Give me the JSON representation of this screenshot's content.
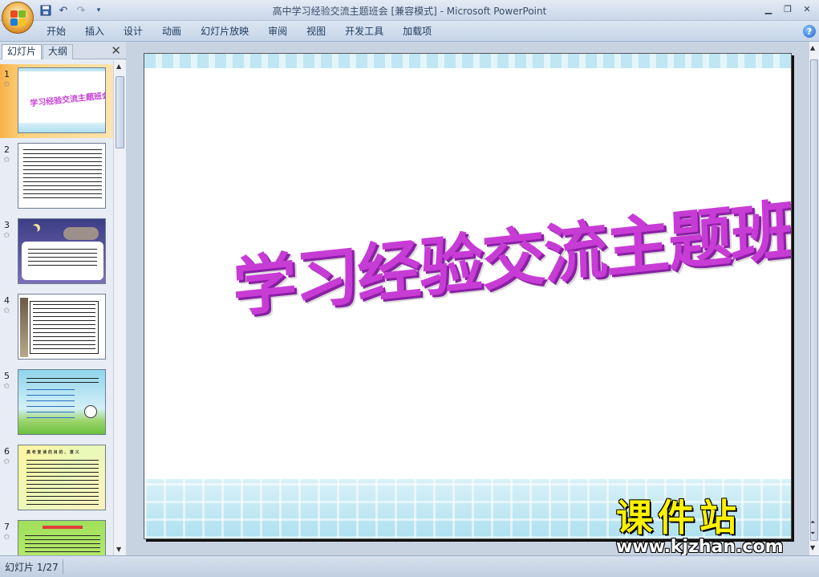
{
  "window": {
    "title": "高中学习经验交流主题班会 [兼容模式] - Microsoft PowerPoint",
    "controls": [
      "minimize-icon",
      "restore-icon",
      "close-icon"
    ]
  },
  "quick_access": [
    "save-icon",
    "undo-icon",
    "redo-icon",
    "customize-icon"
  ],
  "ribbon": {
    "tabs": [
      "开始",
      "插入",
      "设计",
      "动画",
      "幻灯片放映",
      "审阅",
      "视图",
      "开发工具",
      "加载项"
    ]
  },
  "pane": {
    "tab_slides": "幻灯片",
    "tab_outline": "大纲",
    "thumbnails": [
      {
        "number": "1",
        "title": "学习经验交流主题班会",
        "selected": true
      },
      {
        "number": "2"
      },
      {
        "number": "3"
      },
      {
        "number": "4"
      },
      {
        "number": "5"
      },
      {
        "number": "6",
        "heading": "高 考 复 读 的 目 的 、 意 义"
      },
      {
        "number": "7"
      }
    ]
  },
  "slide": {
    "title": "学习经验交流主题班会"
  },
  "watermark": {
    "logo": "课件站",
    "url": "www.kjzhan.com"
  },
  "status": {
    "slide_indicator": "幻灯片 1/27"
  },
  "colors": {
    "title_text": "#c83cd6",
    "title_shadow": "#8a20a4",
    "selected_thumb": "#f9b14a",
    "ribbon": "#c6d5e9"
  }
}
